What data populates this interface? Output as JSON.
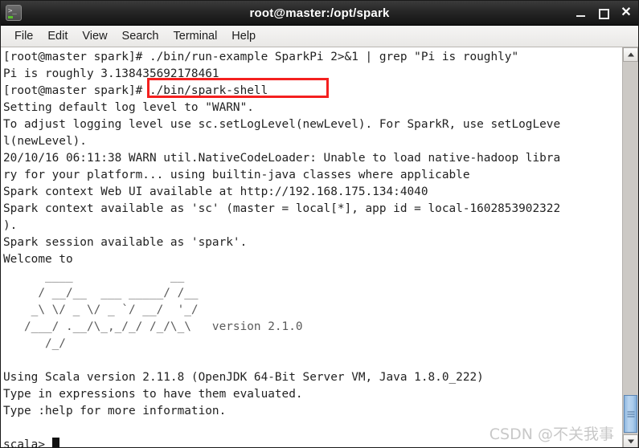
{
  "window": {
    "title": "root@master:/opt/spark",
    "app_icon": "terminal-icon",
    "controls": {
      "minimize": "minimize-icon",
      "maximize": "maximize-icon",
      "close": "close-icon"
    }
  },
  "menubar": {
    "items": [
      {
        "label": "File"
      },
      {
        "label": "Edit"
      },
      {
        "label": "View"
      },
      {
        "label": "Search"
      },
      {
        "label": "Terminal"
      },
      {
        "label": "Help"
      }
    ]
  },
  "terminal": {
    "lines": [
      "[root@master spark]# ./bin/run-example SparkPi 2>&1 | grep \"Pi is roughly\"",
      "Pi is roughly 3.138435692178461",
      "[root@master spark]# ./bin/spark-shell",
      "Setting default log level to \"WARN\".",
      "To adjust logging level use sc.setLogLevel(newLevel). For SparkR, use setLogLeve",
      "l(newLevel).",
      "20/10/16 06:11:38 WARN util.NativeCodeLoader: Unable to load native-hadoop libra",
      "ry for your platform... using builtin-java classes where applicable",
      "Spark context Web UI available at http://192.168.175.134:4040",
      "Spark context available as 'sc' (master = local[*], app id = local-1602853902322",
      ").",
      "Spark session available as 'spark'.",
      "Welcome to",
      "      ____              __",
      "     / __/__  ___ _____/ /__",
      "    _\\ \\/ _ \\/ _ `/ __/  '_/",
      "   /___/ .__/\\_,_/_/ /_/\\_\\   version 2.1.0",
      "      /_/",
      "",
      "Using Scala version 2.11.8 (OpenJDK 64-Bit Server VM, Java 1.8.0_222)",
      "Type in expressions to have them evaluated.",
      "Type :help for more information.",
      "",
      "scala> "
    ],
    "prompt": "scala> ",
    "cursor": "block-cursor"
  },
  "annotation": {
    "label": "./bin/spark-shell",
    "color": "#f4201f",
    "shape": "rectangle"
  },
  "watermark": {
    "text": "CSDN @不关我事"
  },
  "scrollbar": {
    "up_arrow": "scroll-up-icon",
    "down_arrow": "scroll-down-icon",
    "thumb": "scroll-thumb"
  }
}
